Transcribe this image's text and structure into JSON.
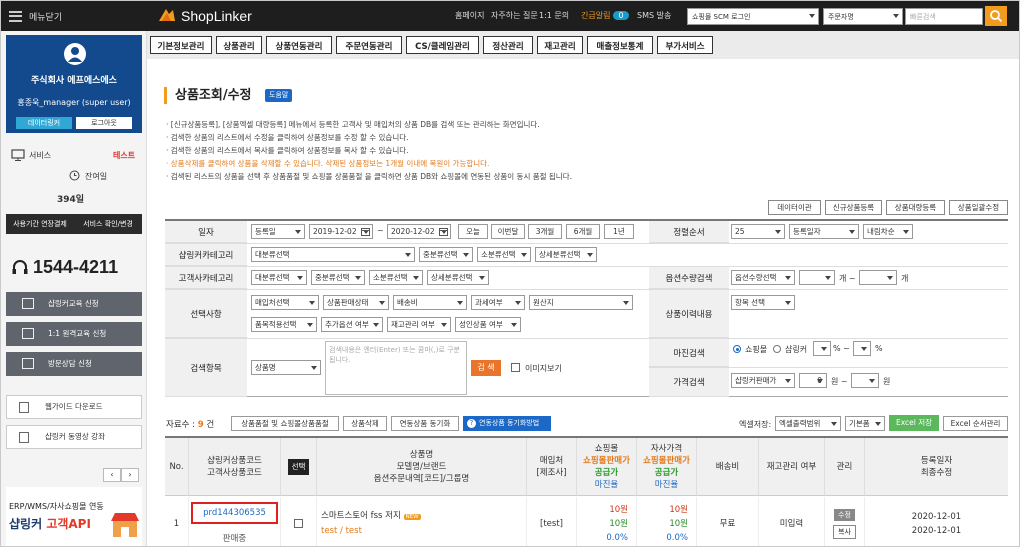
{
  "header": {
    "menu_label": "메뉴닫기",
    "logo": "ShopLinker",
    "links": [
      "홈페이지",
      "자주하는 질문",
      "1:1 문의",
      "긴급알림",
      "SMS 발송"
    ],
    "notice_count": "0",
    "scm_select": "쇼핑몰 SCM 로그인",
    "search_type": "주문자명",
    "search_placeholder": "빠른검색",
    "colors": {
      "topbar": "#1e1e1e",
      "accent": "#f29c1f"
    }
  },
  "tabs": [
    "기본정보관리",
    "상품관리",
    "상품연동관리",
    "주문연동관리",
    "CS/클레임관리",
    "정산관리",
    "재고관리",
    "매출정보통계",
    "부가서비스"
  ],
  "sidebar": {
    "company": "주식회사 에프에스에스",
    "username": "홍종욱_manager (super user)",
    "datalinker": "데이터링커",
    "logout": "로그아웃",
    "service_label": "서비스",
    "service_value": "테스트",
    "remaining_label": "잔여일",
    "remaining_days": "394일",
    "dark_btn1": "사용기간 연장결제",
    "dark_btn2": "서비스 확인/변경",
    "phone": "1544-4211",
    "menu": [
      "샵링커교육 신청",
      "1:1 원격교육 신청",
      "방문상담 신청"
    ],
    "guides": [
      "웹가이드 다운로드",
      "샵링커 동영상 강좌"
    ],
    "api_line1": "ERP/WMS/자사쇼핑몰 연동",
    "api_line2a": "샵링커",
    "api_line2b": "고객API"
  },
  "main": {
    "title": "상품조회/수정",
    "help": "도움말",
    "descriptions": [
      "[신규상품등록], [상품엑셀 대량등록] 메뉴에서 등록한 고객사 및 매입처의 상품 DB를 검색 또는 관리하는 화면입니다.",
      "검색한 상품의 리스트에서 수정을 클릭하여 상품정보를 수정 할 수 있습니다.",
      "검색한 상품의 리스트에서 복사를 클릭하여 상품정보를 복사 할 수 있습니다.",
      "상품삭제를 클릭하여 상품을 삭제할 수 있습니다. 삭제된 상품정보는 1개월 이내에 복원이 가능합니다.",
      "검색된 리스트의 상품을 선택 후 상품품절 및 쇼핑몰 상품품절 을 클릭하면 상품 DB와 쇼핑몰에 연동된 상품이 동시 품절 됩니다."
    ],
    "right_buttons": [
      "데이터이관",
      "신규상품등록",
      "상품대량등록",
      "상품일괄수정"
    ]
  },
  "form": {
    "labels": [
      "일자",
      "샵링커카테고리",
      "고객사카테고리",
      "선택사항",
      "검색항목",
      "정렬순서",
      "옵션수량검색",
      "상품이력내용",
      "마진검색",
      "가격검색"
    ],
    "date_type": "등록일",
    "date_from": "2019-12-02",
    "date_to": "2020-12-02",
    "date_btns": [
      "오늘",
      "이번달",
      "3개월",
      "6개월",
      "1년"
    ],
    "sl_cat": [
      "대분류선택",
      "중분류선택",
      "소분류선택",
      "상세분류선택"
    ],
    "cu_cat": [
      "대분류선택",
      "중분류선택",
      "소분류선택",
      "상세분류선택"
    ],
    "options_row1": [
      "매입처선택",
      "상품판매상태",
      "배송비",
      "과세여부",
      "원산지"
    ],
    "options_row2": [
      "품목적용선택",
      "추가옵션 여부",
      "재고관리 여부",
      "성인상품 여부"
    ],
    "search_field": "상품명",
    "search_placeholder": "검색내용은 엔터(Enter) 또는 콤마(,)로 구분됩니다.",
    "search_btn": "검 색",
    "image_view": "이미지보기",
    "sort_count": "25",
    "sort_field": "등록일자",
    "sort_dir": "내림차순",
    "opt_qty": "옵션수량선택",
    "gae_tilde": "개 ~",
    "gae": "개",
    "history": "항목 선택",
    "margin_shop": "쇼핑몰",
    "margin_linker": "샵링커",
    "pct_tilde": "% ~",
    "pct": "%",
    "price_type": "샵링커판매가",
    "price_from": "0",
    "won_tilde": "원 ~",
    "won": "원",
    "tilde": "~"
  },
  "result": {
    "count_label": "자료수 :",
    "count": "9",
    "count_unit": "건",
    "action_btns": [
      "상품품절 및 쇼핑몰상품품절",
      "상품삭제",
      "연동상품 동기화"
    ],
    "sync_help": "연동상품 동기화방법",
    "excel_label": "엑셀저장:",
    "excel_range": "엑셀출력범위",
    "excel_type": "기본폼",
    "excel_save": "Excel 저장",
    "excel_order": "Excel 순서관리"
  },
  "table": {
    "headers": {
      "no": "No.",
      "code": [
        "샵링커상품코드",
        "고객사상품코드"
      ],
      "select": "선택",
      "name": [
        "상품명",
        "모델명/브랜드",
        "옵션주문내역[코드]/그룹명"
      ],
      "supplier": [
        "매입처",
        "[제조사]"
      ],
      "mall": [
        "쇼핑몰",
        "쇼핑몰판매가",
        "공급가",
        "마진율"
      ],
      "own": [
        "자사가격",
        "쇼핑몰판매가",
        "공급가",
        "마진율"
      ],
      "shipping": "배송비",
      "stock": "재고관리 여부",
      "manage": "관리",
      "dates": [
        "등록일자",
        "최종수정"
      ]
    },
    "rows": [
      {
        "no": "1",
        "code": "prd144306535",
        "status": "판매중",
        "name": "스마트스토어 fss 저지",
        "badge": "NEW",
        "sub": "test / test",
        "supplier": "[test]",
        "mall_price": "10원",
        "mall_supply": "10원",
        "mall_margin": "0.0%",
        "own_price": "10원",
        "own_supply": "10원",
        "own_margin": "0.0%",
        "shipping": "무료",
        "stock": "미입력",
        "edit": "수정",
        "copy": "복사",
        "created": "2020-12-01",
        "modified": "2020-12-01"
      }
    ]
  }
}
